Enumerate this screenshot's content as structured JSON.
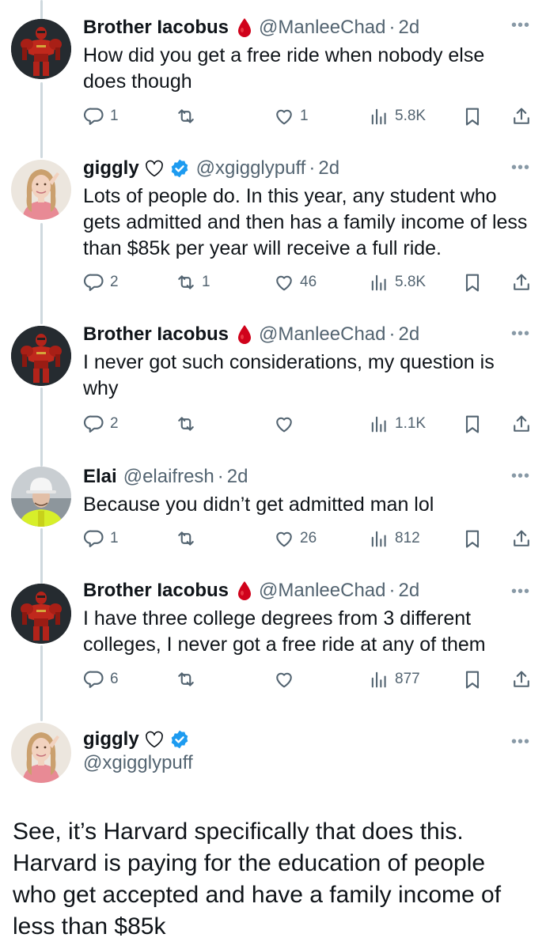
{
  "tweets": [
    {
      "name": "Brother Iacobus",
      "handle": "@ManleeChad",
      "time": "2d",
      "text": "How did you get a free ride when nobody else does though",
      "replies": "1",
      "reposts": "",
      "likes": "1",
      "views": "5.8K",
      "avatar_icon": "space-marine-avatar"
    },
    {
      "name": "giggly",
      "handle": "@xgigglypuff",
      "time": "2d",
      "text": "Lots of people do. In this year, any student who gets admitted and then has a family income of less than $85k per year will receive a full ride.",
      "replies": "2",
      "reposts": "1",
      "likes": "46",
      "views": "5.8K",
      "avatar_icon": "woman-avatar"
    },
    {
      "name": "Brother Iacobus",
      "handle": "@ManleeChad",
      "time": "2d",
      "text": "I never got such considerations, my question is why",
      "replies": "2",
      "reposts": "",
      "likes": "",
      "views": "1.1K",
      "avatar_icon": "space-marine-avatar"
    },
    {
      "name": "Elai",
      "handle": "@elaifresh",
      "time": "2d",
      "text": "Because you didn’t get admitted man lol",
      "replies": "1",
      "reposts": "",
      "likes": "26",
      "views": "812",
      "avatar_icon": "hardhat-avatar"
    },
    {
      "name": "Brother Iacobus",
      "handle": "@ManleeChad",
      "time": "2d",
      "text": "I have three college degrees from 3 different colleges, I never got a free ride at any of them",
      "replies": "6",
      "reposts": "",
      "likes": "",
      "views": "877",
      "avatar_icon": "space-marine-avatar"
    }
  ],
  "focused": {
    "name": "giggly",
    "handle": "@xgigglypuff",
    "text": "See, it’s Harvard specifically that does this. Harvard is paying for the education of people who get accepted and have a family income of less than $85k",
    "avatar_icon": "woman-avatar"
  },
  "colors": {
    "text": "#0f1419",
    "muted": "#536471",
    "verified": "#1d9bf0",
    "drop": "#d0021b",
    "thread": "#cfd9de"
  }
}
